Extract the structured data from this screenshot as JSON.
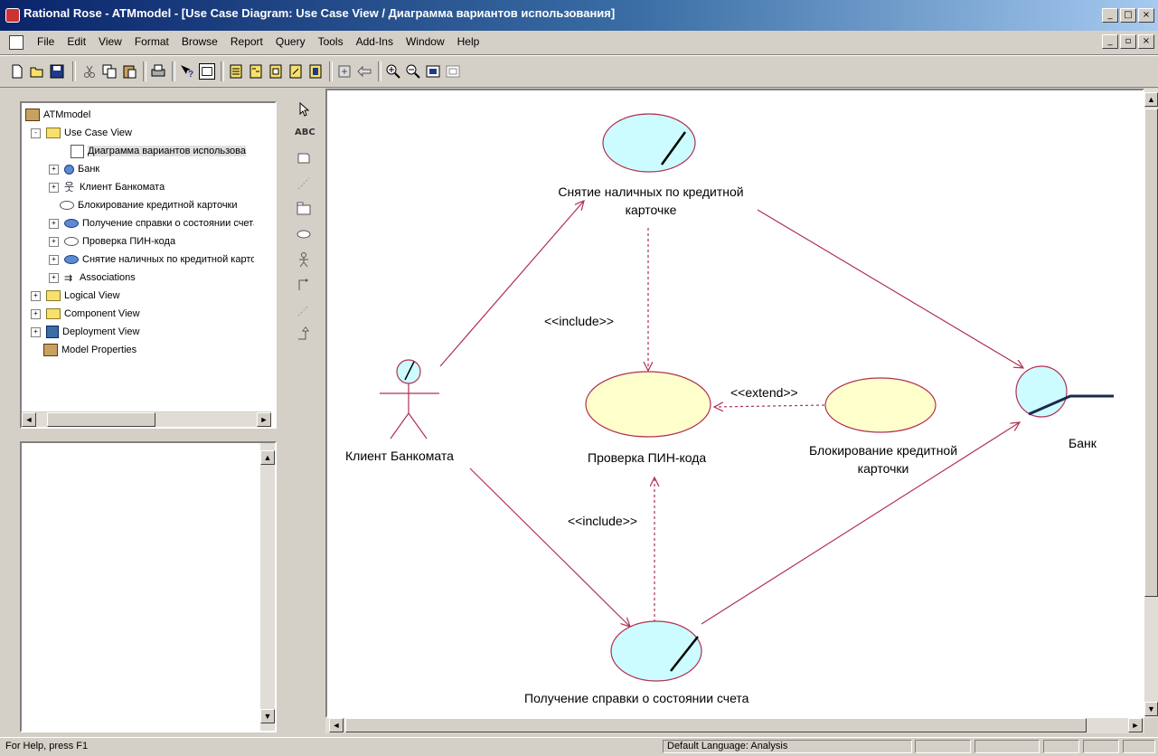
{
  "window": {
    "title": "Rational Rose - ATMmodel - [Use Case Diagram: Use Case View / Диаграмма вариантов использования]",
    "controls": [
      "_",
      "□",
      "×"
    ],
    "child_controls": [
      "_",
      "▫",
      "×"
    ]
  },
  "menu": [
    "File",
    "Edit",
    "View",
    "Format",
    "Browse",
    "Report",
    "Query",
    "Tools",
    "Add-Ins",
    "Window",
    "Help"
  ],
  "toolbar": {
    "icons": [
      "new-icon",
      "open-icon",
      "save-icon",
      "cut-icon",
      "copy-icon",
      "paste-icon",
      "print-icon",
      "context-help-icon",
      "view-doc-icon",
      "browse-class-diagram-icon",
      "browse-interaction-diagram-icon",
      "browse-component-diagram-icon",
      "browse-deployment-diagram-icon",
      "browse-parent-icon",
      "browse-previous-icon",
      "go-back-icon",
      "zoom-in-icon",
      "zoom-out-icon",
      "fit-in-window-icon",
      "undo-fit-icon"
    ]
  },
  "browser": {
    "items": [
      {
        "label": "ATMmodel",
        "icon": "model-icon",
        "expander": ""
      },
      {
        "label": "Use Case View",
        "icon": "folder-icon",
        "expander": "-"
      },
      {
        "label": "Диаграмма вариантов использования",
        "icon": "use-case-diagram-icon",
        "expander": ""
      },
      {
        "label": "Банк",
        "icon": "actor-bank-icon",
        "expander": "+"
      },
      {
        "label": "Клиент Банкомата",
        "icon": "actor-icon",
        "expander": "+"
      },
      {
        "label": "Блокирование кредитной карточки",
        "icon": "use-case-outline-icon",
        "expander": ""
      },
      {
        "label": "Получение справки о состоянии счета",
        "icon": "use-case-icon",
        "expander": "+"
      },
      {
        "label": "Проверка ПИН-кода",
        "icon": "use-case-outline-icon",
        "expander": "+"
      },
      {
        "label": "Снятие наличных по кредитной карточке",
        "icon": "use-case-icon",
        "expander": "+"
      },
      {
        "label": "Associations",
        "icon": "associations-icon",
        "expander": "+"
      },
      {
        "label": "Logical View",
        "icon": "folder-icon",
        "expander": "+"
      },
      {
        "label": "Component View",
        "icon": "folder-icon",
        "expander": "+"
      },
      {
        "label": "Deployment View",
        "icon": "deployment-icon",
        "expander": "+"
      },
      {
        "label": "Model Properties",
        "icon": "properties-icon",
        "expander": ""
      }
    ]
  },
  "toolbox": {
    "tools": [
      "selection-arrow-icon",
      "text-box-tool",
      "note-icon",
      "anchor-note-icon",
      "package-icon",
      "use-case-tool-icon",
      "actor-tool-icon",
      "unidirectional-association-icon",
      "dependency-icon",
      "generalization-icon"
    ],
    "text_tool_label": "ABC"
  },
  "diagram": {
    "use_cases": {
      "cash": "Снятие наличных по кредитной карточке",
      "pin": "Проверка ПИН-кода",
      "block": "Блокирование кредитной карточки",
      "balance": "Получение справки о состоянии счета"
    },
    "actors": {
      "client": "Клиент Банкомата",
      "bank": "Банк"
    },
    "relations": {
      "include_top": "<<include>>",
      "extend": "<<extend>>",
      "include_bottom": "<<include>>"
    },
    "colors": {
      "use_case_fill_primary": "#ccfcff",
      "use_case_fill_secondary": "#ffffcc",
      "line": "#b03050"
    }
  },
  "status": {
    "help": "For Help, press F1",
    "language": "Default Language: Analysis"
  }
}
